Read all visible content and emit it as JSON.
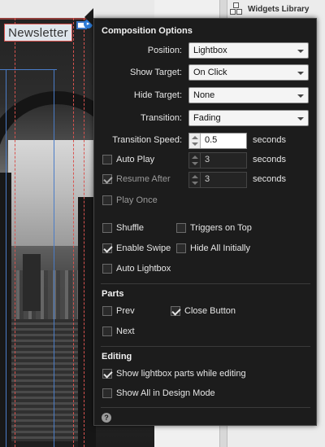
{
  "canvas": {
    "newsletter_text": "Newsletter"
  },
  "side_panel": {
    "widgets_library_label": "Widgets Library"
  },
  "composition_options": {
    "title": "Composition Options",
    "position": {
      "label": "Position:",
      "value": "Lightbox"
    },
    "show_target": {
      "label": "Show Target:",
      "value": "On Click"
    },
    "hide_target": {
      "label": "Hide Target:",
      "value": "None"
    },
    "transition": {
      "label": "Transition:",
      "value": "Fading"
    },
    "transition_speed": {
      "label": "Transition Speed:",
      "value": "0.5",
      "unit": "seconds"
    },
    "auto_play": {
      "label": "Auto Play",
      "checked": false,
      "value": "3",
      "unit": "seconds"
    },
    "resume_after": {
      "label": "Resume After",
      "checked": true,
      "value": "3",
      "unit": "seconds"
    },
    "play_once": {
      "label": "Play Once",
      "checked": false
    },
    "shuffle": {
      "label": "Shuffle",
      "checked": false
    },
    "triggers_on_top": {
      "label": "Triggers on Top",
      "checked": false
    },
    "enable_swipe": {
      "label": "Enable Swipe",
      "checked": true
    },
    "hide_all_initially": {
      "label": "Hide All Initially",
      "checked": false
    },
    "auto_lightbox": {
      "label": "Auto Lightbox",
      "checked": false
    }
  },
  "parts": {
    "title": "Parts",
    "prev": {
      "label": "Prev",
      "checked": false
    },
    "close_button": {
      "label": "Close Button",
      "checked": true
    },
    "next": {
      "label": "Next",
      "checked": false
    }
  },
  "editing": {
    "title": "Editing",
    "show_lightbox_parts": {
      "label": "Show lightbox parts while editing",
      "checked": true
    },
    "show_all_design_mode": {
      "label": "Show All in Design Mode",
      "checked": false
    }
  },
  "help_glyph": "?"
}
